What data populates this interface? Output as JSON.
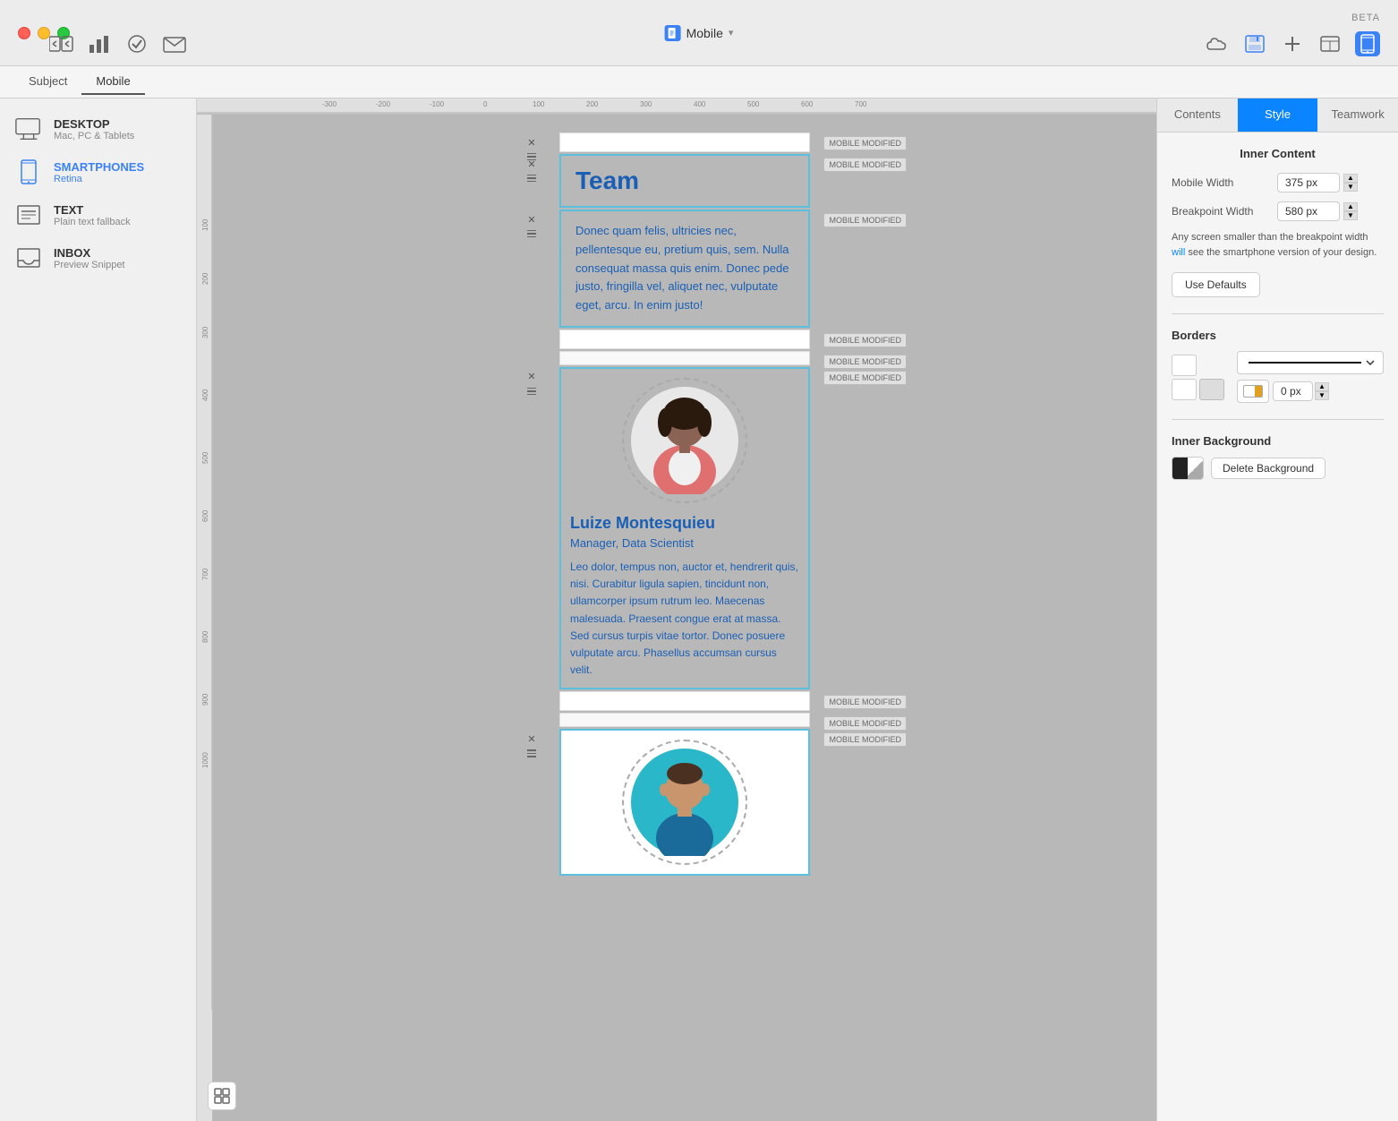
{
  "titlebar": {
    "title": "Mobile",
    "beta": "BETA",
    "dropdown_arrow": "▾"
  },
  "tabs": {
    "subject": "Subject",
    "mobile": "Mobile"
  },
  "sidebar": {
    "items": [
      {
        "id": "desktop",
        "label": "DESKTOP",
        "sublabel": "Mac, PC & Tablets"
      },
      {
        "id": "smartphones",
        "label": "SMARTPHONES",
        "sublabel": "Retina",
        "active": true
      },
      {
        "id": "text",
        "label": "TEXT",
        "sublabel": "Plain text fallback"
      },
      {
        "id": "inbox",
        "label": "INBOX",
        "sublabel": "Preview Snippet"
      }
    ]
  },
  "canvas": {
    "modified_badge": "MOBILE MODIFIED",
    "heading": "Team",
    "body_text": "Donec quam felis, ultricies nec, pellentesque eu, pretium quis, sem. Nulla consequat massa quis enim. Donec pede justo, fringilla vel, aliquet nec, vulputate eget, arcu. In enim justo!",
    "profile1": {
      "name": "Luize Montesquieu",
      "title": "Manager, Data Scientist",
      "bio": "Leo dolor, tempus non, auctor et, hendrerit quis, nisi. Curabitur ligula sapien, tincidunt non, ullamcorper ipsum rutrum leo. Maecenas malesuada. Praesent congue erat at massa. Sed cursus turpis vitae tortor. Donec posuere vulputate arcu. Phasellus accumsan cursus velit."
    }
  },
  "right_panel": {
    "tabs": {
      "contents": "Contents",
      "style": "Style",
      "teamwork": "Teamwork"
    },
    "inner_content": {
      "title": "Inner Content",
      "mobile_width_label": "Mobile Width",
      "mobile_width_value": "375 px",
      "breakpoint_width_label": "Breakpoint Width",
      "breakpoint_width_value": "580 px",
      "info_text": "Any screen smaller than the breakpoint width will see the smartphone version of your design.",
      "use_defaults_btn": "Use Defaults"
    },
    "borders": {
      "title": "Borders",
      "border_px": "0 px"
    },
    "inner_background": {
      "title": "Inner Background",
      "delete_btn": "Delete Background"
    }
  }
}
